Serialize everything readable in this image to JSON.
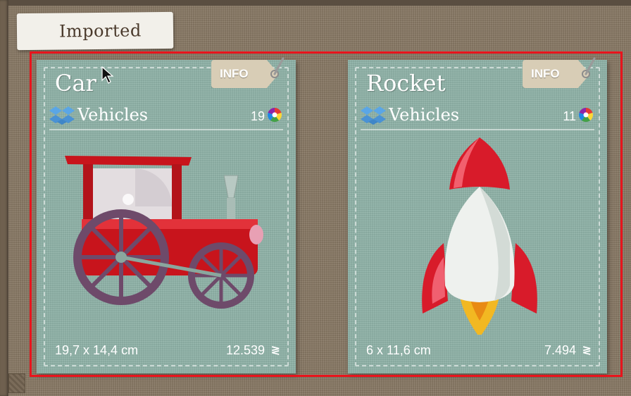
{
  "section": {
    "tab_label": "Imported"
  },
  "cards": [
    {
      "title": "Car",
      "info_label": "INFO",
      "category": "Vehicles",
      "color_count": "19",
      "size": "19,7 x 14,4 cm",
      "stitches": "12.539",
      "art_icon": "tractor-embroidery"
    },
    {
      "title": "Rocket",
      "info_label": "INFO",
      "category": "Vehicles",
      "color_count": "11",
      "size": "6 x 11,6 cm",
      "stitches": "7.494",
      "art_icon": "rocket-embroidery"
    }
  ],
  "colors": {
    "selection": "#e8141c",
    "card": "#8fb3a8",
    "background": "#8a7a66"
  }
}
